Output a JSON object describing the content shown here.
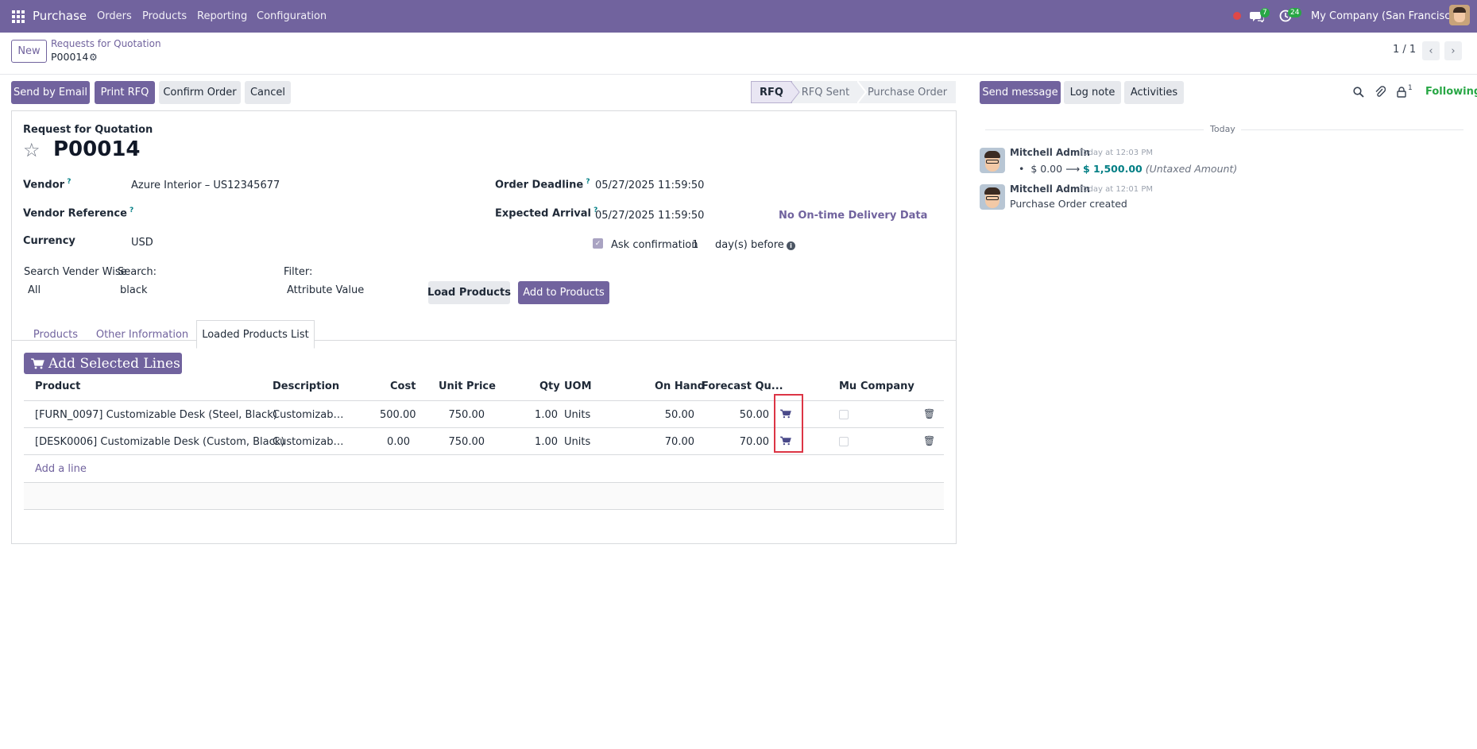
{
  "navbar": {
    "app_name": "Purchase",
    "menu": [
      "Orders",
      "Products",
      "Reporting",
      "Configuration"
    ],
    "messages_badge": "7",
    "activities_badge": "24",
    "company": "My Company (San Francisco)"
  },
  "control": {
    "new_label": "New",
    "breadcrumb_parent": "Requests for Quotation",
    "breadcrumb_current": "P00014",
    "pager": "1 / 1"
  },
  "actions": {
    "send_email": "Send by Email",
    "print_rfq": "Print RFQ",
    "confirm_order": "Confirm Order",
    "cancel": "Cancel"
  },
  "status": [
    "RFQ",
    "RFQ Sent",
    "Purchase Order"
  ],
  "chatter_buttons": {
    "send_message": "Send message",
    "log_note": "Log note",
    "activities": "Activities",
    "followers_count": "1",
    "following": "Following"
  },
  "form": {
    "subtitle": "Request for Quotation",
    "name": "P00014",
    "vendor_label": "Vendor",
    "vendor_value": "Azure Interior – US12345677",
    "vendor_ref_label": "Vendor Reference",
    "currency_label": "Currency",
    "currency_value": "USD",
    "order_deadline_label": "Order Deadline",
    "order_deadline_value": "05/27/2025 11:59:50",
    "expected_arrival_label": "Expected Arrival",
    "expected_arrival_value": "05/27/2025 11:59:50",
    "on_time_link": "No On-time Delivery Data",
    "ask_confirmation_label": "Ask confirmation",
    "ask_confirmation_days": "1",
    "days_before": "day(s) before",
    "search_vendor_wise_label": "Search Vender Wise",
    "search_vendor_wise_value": "All",
    "search_label": "Search:",
    "search_value": "black",
    "filter_label": "Filter:",
    "filter_value": "Attribute Value",
    "load_products": "Load Products",
    "add_to_products": "Add to Products"
  },
  "tabs": [
    "Products",
    "Other Information",
    "Loaded Products List"
  ],
  "lines": {
    "add_selected_label": "Add Selected Lines",
    "headers": [
      "Product",
      "Description",
      "Cost",
      "Unit Price",
      "Qty",
      "UOM",
      "On Hand",
      "Forecast Qu...",
      "Mu",
      "Company"
    ],
    "rows": [
      {
        "product": "[FURN_0097] Customizable Desk (Steel, Black)",
        "description": "Customizab…",
        "cost": "500.00",
        "unit_price": "750.00",
        "qty": "1.00",
        "uom": "Units",
        "on_hand": "50.00",
        "forecast": "50.00"
      },
      {
        "product": "[DESK0006] Customizable Desk (Custom, Black)",
        "description": "Customizab…",
        "cost": "0.00",
        "unit_price": "750.00",
        "qty": "1.00",
        "uom": "Units",
        "on_hand": "70.00",
        "forecast": "70.00"
      }
    ],
    "add_line": "Add a line"
  },
  "chatter": {
    "today": "Today",
    "messages": [
      {
        "author": "Mitchell Admin",
        "time": "Today at 12:03 PM",
        "old_value": "$ 0.00",
        "new_value": "$ 1,500.00",
        "field": "(Untaxed Amount)"
      },
      {
        "author": "Mitchell Admin",
        "time": "Today at 12:01 PM",
        "body": "Purchase Order created"
      }
    ]
  },
  "colors": {
    "brand": "#71639e",
    "highlight_box": "#dc3545",
    "teal": "#017e84"
  }
}
